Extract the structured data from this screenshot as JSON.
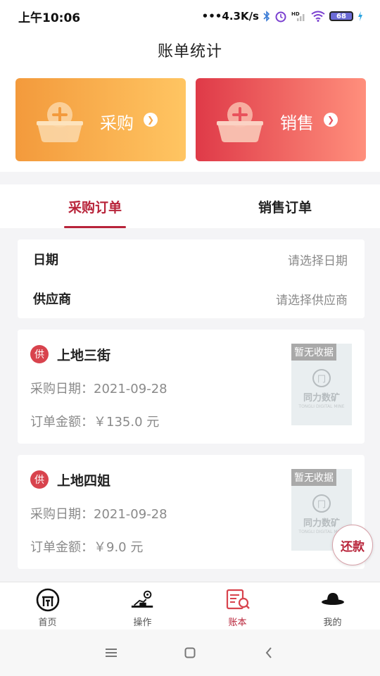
{
  "status_bar": {
    "time": "上午10:06",
    "network_speed": "•••4.3K/s",
    "signal_label": "HD",
    "battery": "68"
  },
  "header": {
    "title": "账单统计"
  },
  "top_cards": {
    "purchase_label": "采购",
    "sales_label": "销售"
  },
  "tabs": [
    {
      "label": "采购订单",
      "active": true
    },
    {
      "label": "销售订单",
      "active": false
    }
  ],
  "filter": {
    "date_label": "日期",
    "date_placeholder": "请选择日期",
    "supplier_label": "供应商",
    "supplier_placeholder": "请选择供应商"
  },
  "orders": [
    {
      "badge": "供",
      "name": "上地三街",
      "date_line": "采购日期：2021-09-28",
      "amount_line": "订单金额：￥135.0 元",
      "stamp": "暂无收据",
      "brand": "同力数矿",
      "brand_en": "TONGLI DIGITAL MINE"
    },
    {
      "badge": "供",
      "name": "上地四姐",
      "date_line": "采购日期：2021-09-28",
      "amount_line": "订单金额：￥9.0 元",
      "stamp": "暂无收据",
      "brand": "同力数矿",
      "brand_en": "TONGLI DIGITAL MINE"
    }
  ],
  "repay_button": "还款",
  "bottom_nav": [
    {
      "label": "首页",
      "icon": "home-logo-icon",
      "active": false
    },
    {
      "label": "操作",
      "icon": "excavator-gear-icon",
      "active": false
    },
    {
      "label": "账本",
      "icon": "ledger-search-icon",
      "active": true
    },
    {
      "label": "我的",
      "icon": "hat-icon",
      "active": false
    }
  ],
  "colors": {
    "accent": "#b8243a",
    "purchase_gradient": [
      "#f39a3c",
      "#ffc562"
    ],
    "sales_gradient": [
      "#df3a48",
      "#ff8f7c"
    ]
  }
}
